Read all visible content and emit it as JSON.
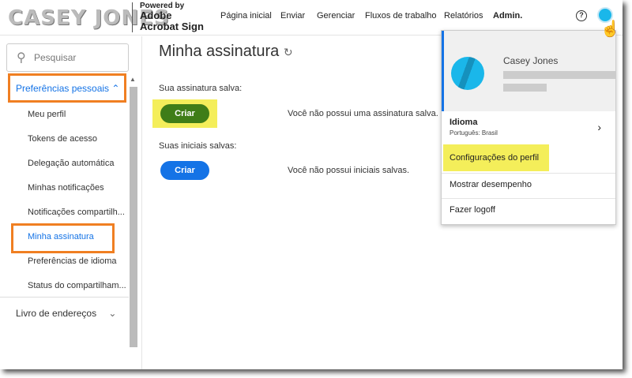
{
  "header": {
    "logo": "CASEY JONES",
    "powered_by": "Powered by",
    "brand_line1": "Adobe",
    "brand_line2": "Acrobat Sign",
    "nav": [
      "Página inicial",
      "Enviar",
      "Gerenciar",
      "Fluxos de trabalho",
      "Relatórios",
      "Admin."
    ],
    "help": "?"
  },
  "sidebar": {
    "search_placeholder": "Pesquisar",
    "group": "Preferências pessoais",
    "items": [
      "Meu perfil",
      "Tokens de acesso",
      "Delegação automática",
      "Minhas notificações",
      "Notificações compartilh...",
      "Minha assinatura",
      "Preferências de idioma",
      "Status do compartilham..."
    ],
    "address_book": "Livro de endereços"
  },
  "main": {
    "title": "Minha assinatura",
    "signature_label": "Sua assinatura salva:",
    "create": "Criar",
    "no_signature": "Você não possui uma assinatura salva.",
    "initials_label": "Suas iniciais salvas:",
    "no_initials": "Você não possui iniciais salvas."
  },
  "dropdown": {
    "name": "Casey Jones",
    "language_label": "Idioma",
    "language_value": "Português: Brasil",
    "profile_settings": "Configurações do perfil",
    "show_performance": "Mostrar desempenho",
    "logoff": "Fazer logoff"
  }
}
